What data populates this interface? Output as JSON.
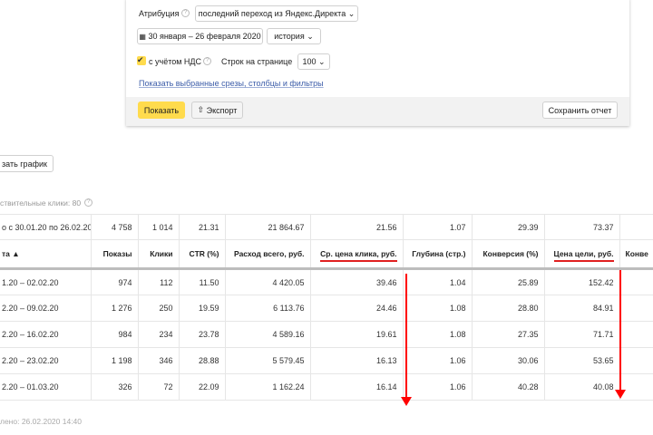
{
  "filters": {
    "attribution_label": "Атрибуция",
    "attribution_value": "последний переход из Яндекс.Директа",
    "date_range": "30 января – 26 февраля 2020",
    "history": "история",
    "vat_label": "с учётом НДС",
    "rows_label": "Строк на странице",
    "rows_value": "100",
    "show_link": "Показать выбранные срезы, столбцы и фильтры",
    "show_button": "Показать",
    "export_button": "Экспорт",
    "save_button": "Сохранить отчет"
  },
  "chart_button": "зать график",
  "clicks_note": "ствительные клики: 80",
  "table": {
    "total": [
      "о с 30.01.20 по 26.02.20",
      "4 758",
      "1 014",
      "21.31",
      "21 864.67",
      "21.56",
      "1.07",
      "29.39",
      "73.37",
      ""
    ],
    "headers": [
      "та ▲",
      "Показы",
      "Клики",
      "CTR (%)",
      "Расход всего, руб.",
      "Ср. цена клика, руб.",
      "Глубина (стр.)",
      "Конверсия (%)",
      "Цена цели, руб.",
      "Конве"
    ],
    "rows": [
      [
        "1.20 – 02.02.20",
        "974",
        "112",
        "11.50",
        "4 420.05",
        "39.46",
        "1.04",
        "25.89",
        "152.42",
        ""
      ],
      [
        "2.20 – 09.02.20",
        "1 276",
        "250",
        "19.59",
        "6 113.76",
        "24.46",
        "1.08",
        "28.80",
        "84.91",
        ""
      ],
      [
        "2.20 – 16.02.20",
        "984",
        "234",
        "23.78",
        "4 589.16",
        "19.61",
        "1.08",
        "27.35",
        "71.71",
        ""
      ],
      [
        "2.20 – 23.02.20",
        "1 198",
        "346",
        "28.88",
        "5 579.45",
        "16.13",
        "1.06",
        "30.06",
        "53.65",
        ""
      ],
      [
        "2.20 – 01.03.20",
        "326",
        "72",
        "22.09",
        "1 162.24",
        "16.14",
        "1.06",
        "40.28",
        "40.08",
        ""
      ]
    ]
  },
  "updated": "лено: 26.02.2020 14:40",
  "colors": {
    "accent": "#ffdb4d",
    "arrow": "#ff0000",
    "link": "#3b5ca8"
  }
}
